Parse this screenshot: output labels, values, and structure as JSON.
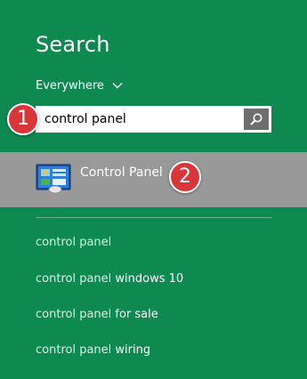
{
  "search_pane": {
    "title": "Search",
    "scope": "Everywhere",
    "query": "control panel",
    "search_button_icon": "magnifier-icon"
  },
  "annotations": {
    "badge_1": "1",
    "badge_2": "2",
    "badge_color": "#d9363a"
  },
  "top_result": {
    "label": "Control Panel",
    "icon": "control-panel-icon",
    "highlight_color": "#999999"
  },
  "suggestions": [
    {
      "prefix": "control panel",
      "suffix": ""
    },
    {
      "prefix": "control panel",
      "suffix": "windows 10"
    },
    {
      "prefix": "control panel",
      "suffix": "for sale"
    },
    {
      "prefix": "control panel",
      "suffix": "wiring"
    }
  ],
  "colors": {
    "background": "#0e8a51",
    "text": "#ffffff"
  }
}
